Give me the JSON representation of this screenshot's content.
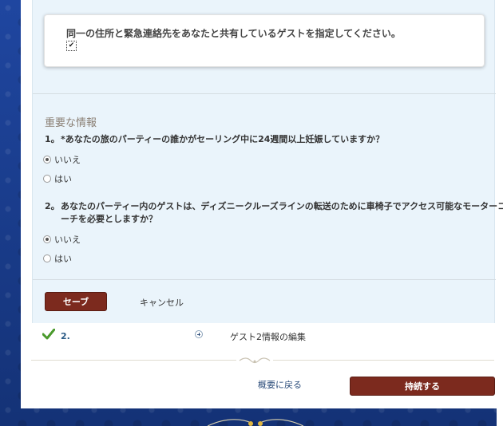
{
  "notice": {
    "text": "同一の住所と緊急連絡先をあなたと共有しているゲストを指定してください。",
    "checkbox_checked": true
  },
  "important": {
    "title": "重要な情報",
    "questions": [
      {
        "num": "1。",
        "text": "*あなたの旅のパーティーの誰かがセーリング中に24週間以上妊娠していますか？",
        "options": [
          {
            "label": "いいえ",
            "selected": true
          },
          {
            "label": "はい",
            "selected": false
          }
        ]
      },
      {
        "num": "2。",
        "text": "あなたのパーティー内のゲストは、ディズニークルーズラインの転送のために車椅子でアクセス可能なモーターコ",
        "text2": "ーチを必要としますか？",
        "options": [
          {
            "label": "いいえ",
            "selected": true
          },
          {
            "label": "はい",
            "selected": false
          }
        ]
      }
    ]
  },
  "actions": {
    "save_label": "セーブ",
    "cancel_label": "キャンセル"
  },
  "guest2": {
    "num": "2.",
    "edit_label": "ゲスト2情報の編集"
  },
  "footer": {
    "back_label": "概要に戻る",
    "continue_label": "持続する"
  },
  "colors": {
    "brand_button": "#7c2a1e",
    "panel_bg": "#eaf4fb",
    "backdrop": "#1b3b8a",
    "check_green": "#4a9a2c"
  }
}
